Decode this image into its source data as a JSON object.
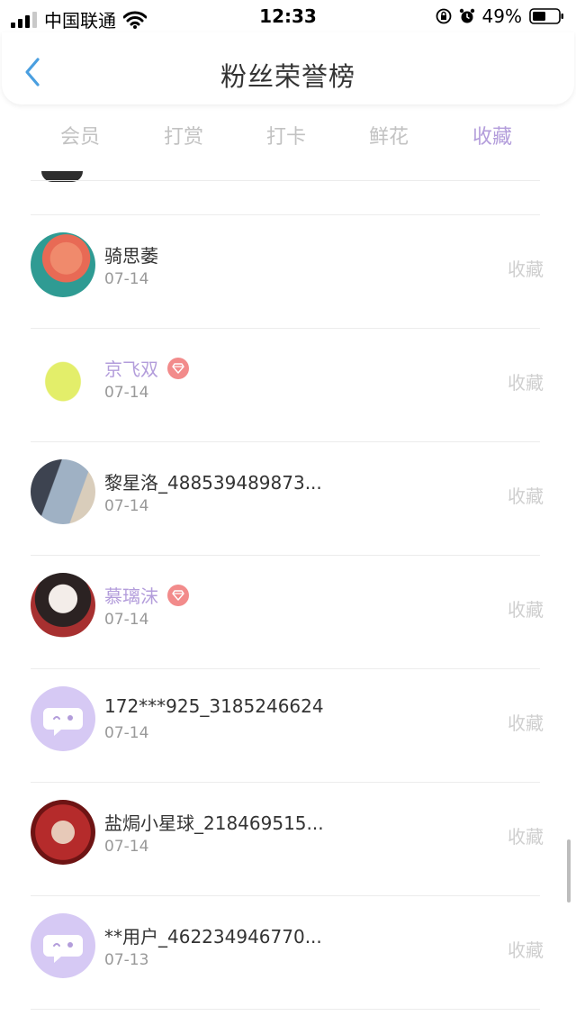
{
  "status_bar": {
    "carrier": "中国联通",
    "time": "12:33",
    "battery": "49%",
    "icons": [
      "signal-icon",
      "wifi-icon",
      "rotation-lock-icon",
      "alarm-icon",
      "battery-icon"
    ]
  },
  "header": {
    "title": "粉丝荣誉榜",
    "back_icon": "chevron-left-icon"
  },
  "tabs": [
    {
      "label": "会员",
      "active": false
    },
    {
      "label": "打赏",
      "active": false
    },
    {
      "label": "打卡",
      "active": false
    },
    {
      "label": "鲜花",
      "active": false
    },
    {
      "label": "收藏",
      "active": true
    }
  ],
  "colors": {
    "accent": "#b39ddb",
    "badge": "#f28b8b",
    "tab_inactive": "#c2c2c2",
    "action_text": "#cfcfcf"
  },
  "list": [
    {
      "name": "骑思萎",
      "date": "07-14",
      "action": "收藏",
      "vip": false,
      "avatar": "photo"
    },
    {
      "name": "京飞双",
      "date": "07-14",
      "action": "收藏",
      "vip": true,
      "avatar": "photo"
    },
    {
      "name": "黎星洛_488539489873...",
      "date": "07-14",
      "action": "收藏",
      "vip": false,
      "avatar": "photo"
    },
    {
      "name": "慕璃沫",
      "date": "07-14",
      "action": "收藏",
      "vip": true,
      "avatar": "photo"
    },
    {
      "name": "172***925_3185246624",
      "date": "07-14",
      "action": "收藏",
      "vip": false,
      "avatar": "default-chat-bubble"
    },
    {
      "name": "盐焗小星球_218469515...",
      "date": "07-14",
      "action": "收藏",
      "vip": false,
      "avatar": "photo"
    },
    {
      "name": "**用户_462234946770...",
      "date": "07-13",
      "action": "收藏",
      "vip": false,
      "avatar": "default-chat-bubble"
    }
  ]
}
